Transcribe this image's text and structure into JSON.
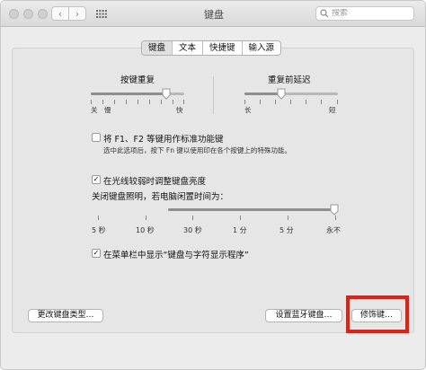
{
  "window": {
    "title": "键盘",
    "search_placeholder": "搜索"
  },
  "tabs": [
    {
      "label": "键盘",
      "active": true
    },
    {
      "label": "文本",
      "active": false
    },
    {
      "label": "快捷键",
      "active": false
    },
    {
      "label": "输入源",
      "active": false
    }
  ],
  "key_repeat": {
    "label": "按键重复",
    "min_label": "关",
    "slow_label": "慢",
    "max_label": "快",
    "value_fraction": 0.82
  },
  "delay_until_repeat": {
    "label": "重复前延迟",
    "min_label": "长",
    "max_label": "短",
    "value_fraction": 0.4
  },
  "fn_keys": {
    "label": "将 F1、F2 等键用作标准功能键",
    "description": "选中此选项后，按下 Fn 键以使用印在各个按键上的特殊功能。",
    "checked": false
  },
  "adjust_brightness": {
    "label": "在光线较弱时调整键盘亮度",
    "checked": true
  },
  "turn_off_backlight": {
    "label": "关闭键盘照明，若电脑闲置时间为：",
    "ticks": [
      "5 秒",
      "10 秒",
      "30 秒",
      "1 分",
      "5 分",
      "永不"
    ],
    "selected": "永不",
    "value_fraction": 1.0
  },
  "show_viewer": {
    "label": "在菜单栏中显示“键盘与字符显示程序”",
    "checked": true
  },
  "buttons": {
    "change_type": "更改键盘类型…",
    "bluetooth": "设置蓝牙键盘…",
    "modifier": "修饰键…"
  },
  "colors": {
    "highlight": "#ee1c0e"
  }
}
